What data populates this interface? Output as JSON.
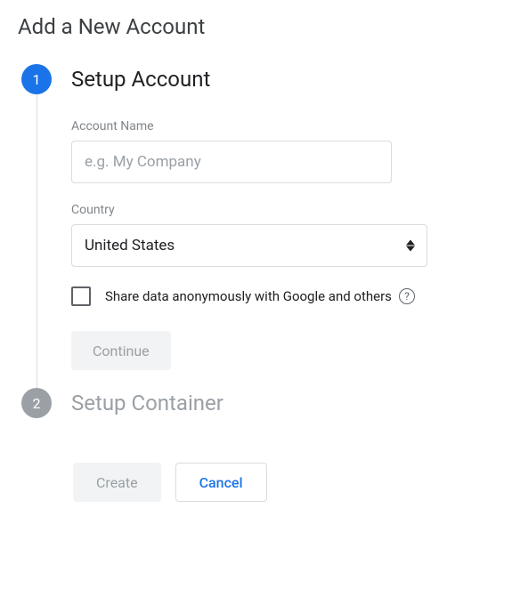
{
  "page": {
    "title": "Add a New Account"
  },
  "steps": {
    "step1": {
      "number": "1",
      "title": "Setup Account",
      "account_name": {
        "label": "Account Name",
        "placeholder": "e.g. My Company",
        "value": ""
      },
      "country": {
        "label": "Country",
        "selected": "United States"
      },
      "share_checkbox": {
        "label": "Share data anonymously with Google and others"
      },
      "continue_label": "Continue"
    },
    "step2": {
      "number": "2",
      "title": "Setup Container"
    }
  },
  "footer": {
    "create_label": "Create",
    "cancel_label": "Cancel"
  }
}
